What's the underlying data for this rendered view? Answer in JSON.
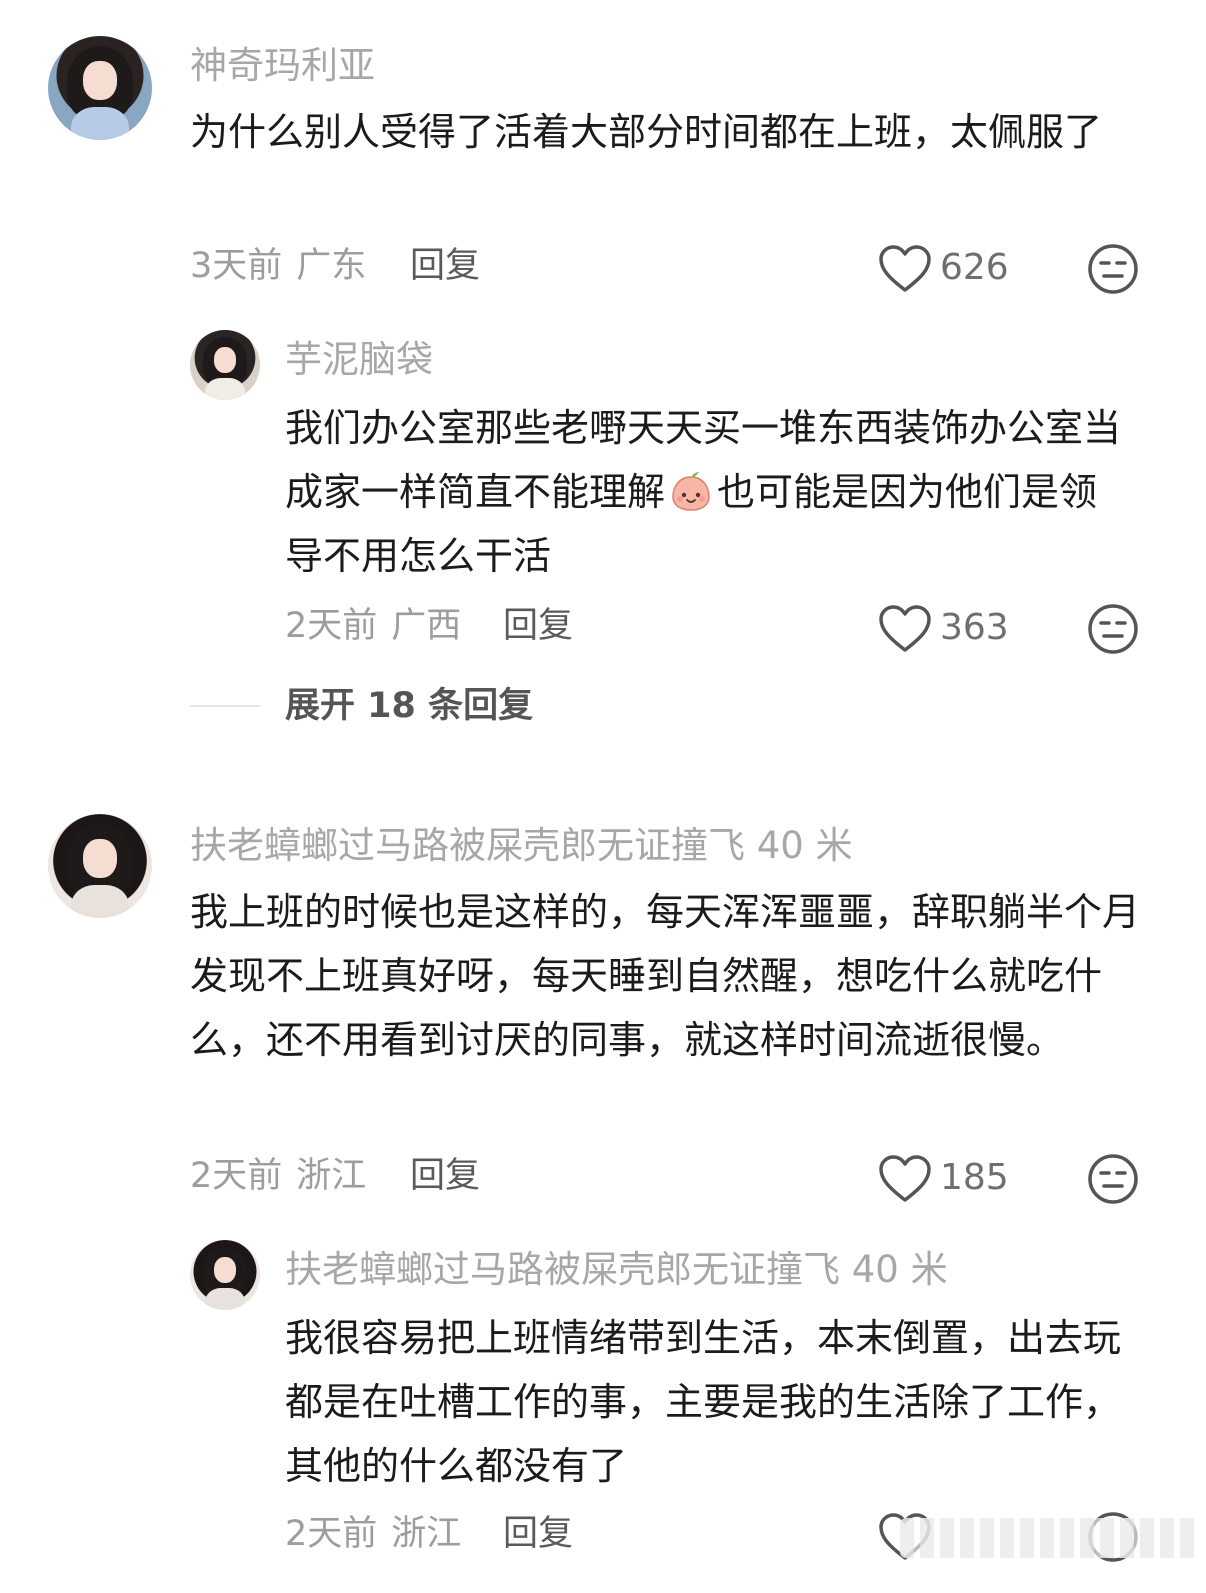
{
  "comments": [
    {
      "username": "神奇玛利亚",
      "text": "为什么别人受得了活着大部分时间都在上班，太佩服了",
      "time": "3天前",
      "location": "广东",
      "reply_label": "回复",
      "likes": "626",
      "replies": [
        {
          "username": "芋泥脑袋",
          "text_before_emoji": "我们办公室那些老嘢天天买一堆东西装饰办公室当成家一样简直不能理解",
          "emoji": "peach-face-emoji",
          "text_after_emoji": "也可能是因为他们是领导不用怎么干活",
          "time": "2天前",
          "location": "广西",
          "reply_label": "回复",
          "likes": "363"
        }
      ],
      "expand_label": "展开 18 条回复"
    },
    {
      "username": "扶老蟑螂过马路被屎壳郎无证撞飞 40 米",
      "text": "我上班的时候也是这样的，每天浑浑噩噩，辞职躺半个月发现不上班真好呀，每天睡到自然醒，想吃什么就吃什么，还不用看到讨厌的同事，就这样时间流逝很慢。",
      "time": "2天前",
      "location": "浙江",
      "reply_label": "回复",
      "likes": "185",
      "replies": [
        {
          "username": "扶老蟑螂过马路被屎壳郎无证撞飞 40 米",
          "text": "我很容易把上班情绪带到生活，本末倒置，出去玩都是在吐槽工作的事，主要是我的生活除了工作，其他的什么都没有了",
          "time": "2天前",
          "location": "浙江",
          "reply_label": "回复"
        }
      ]
    }
  ],
  "icons": {
    "like": "heart-outline-icon",
    "dislike": "meh-face-icon"
  },
  "colors": {
    "username": "#a7a7a7",
    "text": "#1b1b1b",
    "meta": "#9d9d9d"
  }
}
